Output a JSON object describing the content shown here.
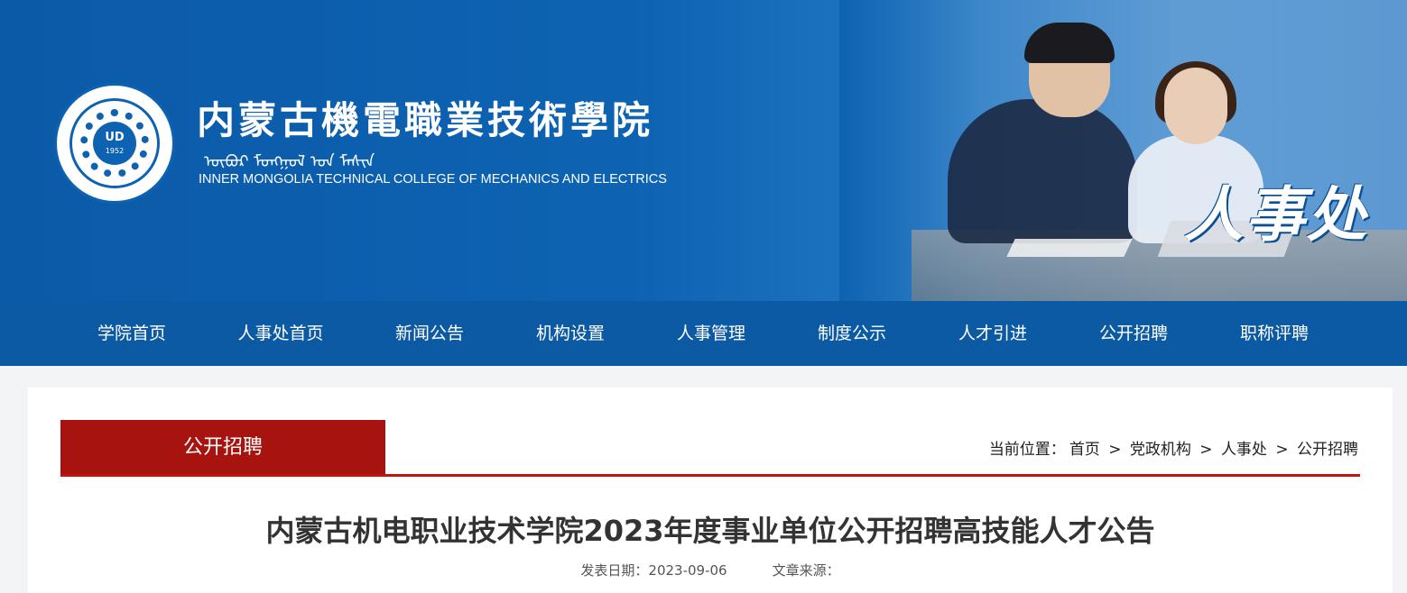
{
  "header": {
    "college_name_cn": "内蒙古機電職業技術學院",
    "college_name_mn": "ᠥᠪᠦᠷ ᠮᠣᠩᠭᠣᠯ ᠤᠨ ᠮᠠᠱᠢᠨ",
    "college_name_en": "INNER MONGOLIA TECHNICAL COLLEGE OF MECHANICS AND ELECTRICS",
    "logo_monogram": "UD",
    "logo_year": "1952",
    "department": "人事处"
  },
  "nav": {
    "items": [
      {
        "label": "学院首页"
      },
      {
        "label": "人事处首页"
      },
      {
        "label": "新闻公告"
      },
      {
        "label": "机构设置"
      },
      {
        "label": "人事管理"
      },
      {
        "label": "制度公示"
      },
      {
        "label": "人才引进"
      },
      {
        "label": "公开招聘"
      },
      {
        "label": "职称评聘"
      }
    ]
  },
  "section": {
    "title": "公开招聘"
  },
  "breadcrumb": {
    "prefix": "当前位置：",
    "items": [
      "首页",
      "党政机构",
      "人事处",
      "公开招聘"
    ],
    "separator": ">"
  },
  "article": {
    "title": "内蒙古机电职业技术学院2023年度事业单位公开招聘高技能人才公告",
    "date_label": "发表日期：",
    "date": "2023-09-06",
    "source_label": "文章来源："
  },
  "colors": {
    "banner_blue": "#0d63b2",
    "nav_blue": "#0c5aa3",
    "accent_red": "#a7130f"
  }
}
